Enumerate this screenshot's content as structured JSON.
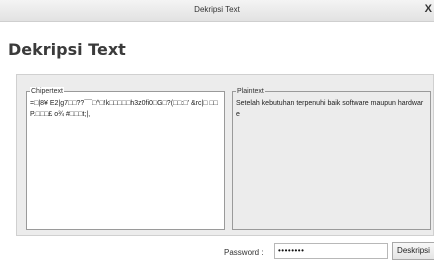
{
  "window": {
    "title": "Dekripsi Text",
    "close_glyph": "X"
  },
  "heading": "Dekripsi Text",
  "ciphertext": {
    "label": "Chipertext",
    "value": "=□|8¥ E2|g7□□??¯¯□^□!k□□□□□h3z0fi0□G□?(□□:□' &rc|□ □□P.□□□£ o¾ #□□□t;|,"
  },
  "plaintext": {
    "label": "Plaintext",
    "value": "Setelah kebutuhan terpenuhi baik software maupun hardware"
  },
  "password": {
    "label": "Password :",
    "value": "••••••••"
  },
  "decrypt_button": {
    "label": "Deskripsi"
  }
}
